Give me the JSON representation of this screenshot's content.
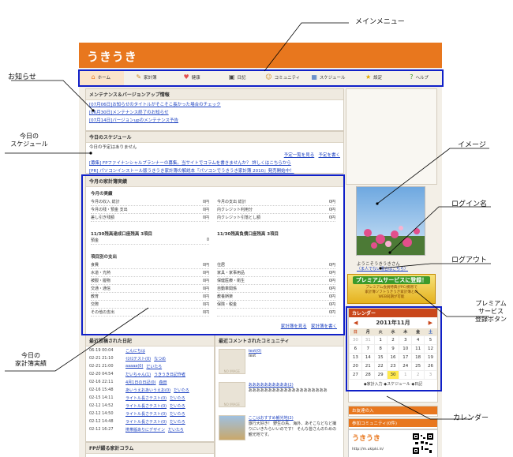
{
  "callouts": {
    "main_menu": "メインメニュー",
    "news": "お知らせ",
    "schedule_l1": "今日の",
    "schedule_l2": "スケジュール",
    "image": "イメージ",
    "login_name": "ログイン名",
    "logout": "ログアウト",
    "premium_l1": "プレミアム",
    "premium_l2": "サービス",
    "premium_l3": "登録ボタン",
    "budget_l1": "今日の",
    "budget_l2": "家計簿実績",
    "calendar": "カレンダー"
  },
  "site": {
    "logo": "うきうき",
    "nav": [
      {
        "label": "ホーム",
        "icon": "⌂"
      },
      {
        "label": "家計簿",
        "icon": "✎"
      },
      {
        "label": "健康",
        "icon": "♥"
      },
      {
        "label": "日記",
        "icon": "▣"
      },
      {
        "label": "コミュニティ",
        "icon": "☺"
      },
      {
        "label": "スケジュール",
        "icon": "▦"
      },
      {
        "label": "設定",
        "icon": "★"
      },
      {
        "label": "ヘルプ",
        "icon": "?"
      }
    ]
  },
  "news": {
    "title": "メンテナンス＆バージョンアップ情報",
    "items": [
      "[07月06日]お知らせのタイトルがそこそこ長かった場合のチェック",
      "[06月30日]メンテナンス終了のお知らせ",
      "[07月14日]バージョンupのメンテナンス予告"
    ]
  },
  "schedule": {
    "title": "今日のスケジュール",
    "empty": "今日の予定はありません",
    "link_list": "予定一覧を見る",
    "link_new": "予定を書く",
    "promo1": "[募集] FPファイナンシャルプランナーの募集。当サイトでコラムを書きませんか？ 詳しくはこちらから",
    "promo2": "[PR] パソコンインストール版うきうき家計簿の解説本『パソコンでうきうき家計簿 2010』発売開始中！"
  },
  "budget": {
    "title": "今月の家計簿実績",
    "actual_heading": "今月の実績",
    "left_rows": [
      {
        "label": "今月の収入 総計",
        "value": "0円"
      },
      {
        "label": "今月の残・預金 支出",
        "value": "0円"
      },
      {
        "label": "差し引き残額",
        "value": "0円"
      }
    ],
    "right_rows": [
      {
        "label": "今月の支出 総計",
        "value": "0円"
      },
      {
        "label": "内クレジット利用分",
        "value": "0円"
      },
      {
        "label": "内クレジット引落とし額",
        "value": "0円"
      }
    ],
    "left_sub_heading": "11/30残高達成口座残高 3項目",
    "left_sub_row": {
      "label": "預金",
      "value": "0"
    },
    "right_sub_heading": "11/30残高負債口座残高 3項目",
    "items_heading": "項目別の支出",
    "item_left": [
      {
        "label": "食費",
        "value": "0円"
      },
      {
        "label": "水道・光熱",
        "value": "0円"
      },
      {
        "label": "被服・履物",
        "value": "0円"
      },
      {
        "label": "交通・通信",
        "value": "0円"
      },
      {
        "label": "教育",
        "value": "0円"
      },
      {
        "label": "交際",
        "value": "0円"
      },
      {
        "label": "その他の支出",
        "value": "0円"
      }
    ],
    "item_right": [
      {
        "label": "住居",
        "value": "0円"
      },
      {
        "label": "家具・家事用品",
        "value": "0円"
      },
      {
        "label": "保健医療・衛生",
        "value": "0円"
      },
      {
        "label": "自動車関係",
        "value": "0円"
      },
      {
        "label": "教養娯楽",
        "value": "0円"
      },
      {
        "label": "保険・税金",
        "value": "0円"
      },
      {
        "label": "",
        "value": "0円"
      }
    ],
    "link1": "家計簿を見る",
    "link2": "家計簿を書く"
  },
  "recent_diary": {
    "title": "最近投稿された日記",
    "rows": [
      {
        "time": "06-19 00:04",
        "title": "こんにちは",
        "user": ""
      },
      {
        "time": "02-21 21:10",
        "title": "ｲﾛｲﾛテスト(0)",
        "user": "なつめ"
      },
      {
        "time": "02-21 21:00",
        "title": "aaaaa(0)",
        "user": "だいたろ"
      },
      {
        "time": "02-20 04:54",
        "title": "だいちゃん(1)",
        "user": "うきうき日記作者"
      },
      {
        "time": "02-16 22:11",
        "title": "4月1日の日記(0)",
        "user": "森田"
      },
      {
        "time": "02-16 15:48",
        "title": "あいうえおあいうえお(0)",
        "user": "だいたろ"
      },
      {
        "time": "02-15 14:11",
        "title": "ライトル長さテスト(0)",
        "user": "だいたろ"
      },
      {
        "time": "02-12 14:52",
        "title": "ライトル長さテスト(0)",
        "user": "だいたろ"
      },
      {
        "time": "02-12 14:50",
        "title": "ライトル長さテスト(0)",
        "user": "だいたろ"
      },
      {
        "time": "02-12 14:48",
        "title": "ライトル長さテスト(0)",
        "user": "だいたろ"
      },
      {
        "time": "02-12 16:27",
        "title": "携帯版ありにデザイン",
        "user": "だいたろ"
      }
    ],
    "footer": "FPが綴る家計コラム"
  },
  "recent_community": {
    "title": "最近コメントされたコミュニティ",
    "items": [
      {
        "name": "test(0)",
        "desc": "test",
        "badge": "NO IMAGE"
      },
      {
        "name": "ああああああああああ(2)",
        "desc": "ああああああああああああああああああああ",
        "badge": "NO IMAGE"
      },
      {
        "name": "ここはおすすめ観光地(2)",
        "desc": "旅行大好き！ 野生の鳥、海外、あそこなどなど撮りにいきたらいいのです！ そんな皆さんのための観光地です。",
        "badge": ""
      }
    ]
  },
  "sidebar": {
    "welcome": "ようこそうきうきさん",
    "logout_note": "（ま人でない場合はこちら）",
    "premium_line1": "プレミアムサービスに登録！",
    "premium_line2": "プレミアム会員特典がPC/携帯で",
    "premium_line3": "家計簿ソフトうきうき家計簿との",
    "premium_line4": "WEB同期が可能",
    "calendar_title": "カレンダー",
    "calendar_month": "2011年11月",
    "weekdays": [
      "日",
      "月",
      "火",
      "水",
      "木",
      "金",
      "土"
    ],
    "calendar_rows": [
      [
        "30",
        "31",
        "1",
        "2",
        "3",
        "4",
        "5"
      ],
      [
        "6",
        "7",
        "8",
        "9",
        "10",
        "11",
        "12"
      ],
      [
        "13",
        "14",
        "15",
        "16",
        "17",
        "18",
        "19"
      ],
      [
        "20",
        "21",
        "22",
        "23",
        "24",
        "25",
        "26"
      ],
      [
        "27",
        "28",
        "29",
        "30",
        "1",
        "2",
        "3"
      ]
    ],
    "legend": "◆家計入力 ◆スケジュール ◆日記",
    "my_items": "お友達の入",
    "community_join": "参加コミュニティ(0件)",
    "mobile_url": "http://m.ukipki.in/"
  }
}
